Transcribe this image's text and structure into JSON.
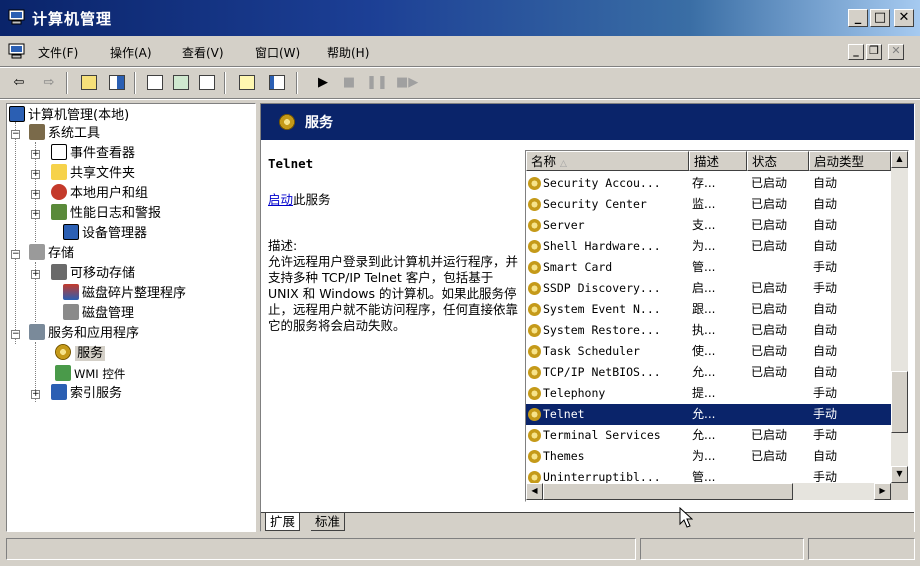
{
  "window": {
    "title": "计算机管理"
  },
  "menubar": {
    "items": [
      "文件(F)",
      "操作(A)",
      "查看(V)",
      "窗口(W)",
      "帮助(H)"
    ]
  },
  "toolbar": {
    "buttons": [
      "back",
      "forward",
      "up-folder",
      "show-hide-tree",
      "properties",
      "refresh",
      "export-list",
      "help",
      "view",
      "play",
      "stop",
      "pause",
      "restart"
    ]
  },
  "tree": {
    "root": "计算机管理(本地)",
    "system_tools": "系统工具",
    "event_viewer": "事件查看器",
    "shared_folders": "共享文件夹",
    "local_users": "本地用户和组",
    "perf_logs": "性能日志和警报",
    "device_manager": "设备管理器",
    "storage": "存储",
    "removable_storage": "可移动存储",
    "defrag": "磁盘碎片整理程序",
    "disk_mgmt": "磁盘管理",
    "services_apps": "服务和应用程序",
    "services": "服务",
    "wmi": "WMI 控件",
    "indexing": "索引服务"
  },
  "services_panel": {
    "header": "服务",
    "selected_name": "Telnet",
    "start_link": "启动",
    "start_suffix": "此服务",
    "desc_label": "描述:",
    "desc_text": "允许远程用户登录到此计算机并运行程序，并支持多种 TCP/IP Telnet 客户，包括基于 UNIX 和 Windows 的计算机。如果此服务停止，远程用户就不能访问程序，任何直接依靠它的服务将会启动失败。"
  },
  "list": {
    "columns": {
      "name": "名称",
      "desc": "描述",
      "status": "状态",
      "startup": "启动类型"
    },
    "rows": [
      {
        "name": "Security Accou...",
        "desc": "存...",
        "status": "已启动",
        "startup": "自动"
      },
      {
        "name": "Security Center",
        "desc": "监...",
        "status": "已启动",
        "startup": "自动"
      },
      {
        "name": "Server",
        "desc": "支...",
        "status": "已启动",
        "startup": "自动"
      },
      {
        "name": "Shell Hardware...",
        "desc": "为...",
        "status": "已启动",
        "startup": "自动"
      },
      {
        "name": "Smart Card",
        "desc": "管...",
        "status": "",
        "startup": "手动"
      },
      {
        "name": "SSDP Discovery...",
        "desc": "启...",
        "status": "已启动",
        "startup": "手动"
      },
      {
        "name": "System Event N...",
        "desc": "跟...",
        "status": "已启动",
        "startup": "自动"
      },
      {
        "name": "System Restore...",
        "desc": "执...",
        "status": "已启动",
        "startup": "自动"
      },
      {
        "name": "Task Scheduler",
        "desc": "使...",
        "status": "已启动",
        "startup": "自动"
      },
      {
        "name": "TCP/IP NetBIOS...",
        "desc": "允...",
        "status": "已启动",
        "startup": "自动"
      },
      {
        "name": "Telephony",
        "desc": "提...",
        "status": "",
        "startup": "手动"
      },
      {
        "name": "Telnet",
        "desc": "允...",
        "status": "",
        "startup": "手动"
      },
      {
        "name": "Terminal Services",
        "desc": "允...",
        "status": "已启动",
        "startup": "手动"
      },
      {
        "name": "Themes",
        "desc": "为...",
        "status": "已启动",
        "startup": "自动"
      },
      {
        "name": "Uninterruptibl...",
        "desc": "管...",
        "status": "",
        "startup": "手动"
      }
    ],
    "selected_index": 11
  },
  "tabs": {
    "extended": "扩展",
    "standard": "标准"
  },
  "colors": {
    "title": "#0a246a",
    "selection": "#0a246a",
    "chrome": "#d4d0c8",
    "link": "#0000cc"
  }
}
